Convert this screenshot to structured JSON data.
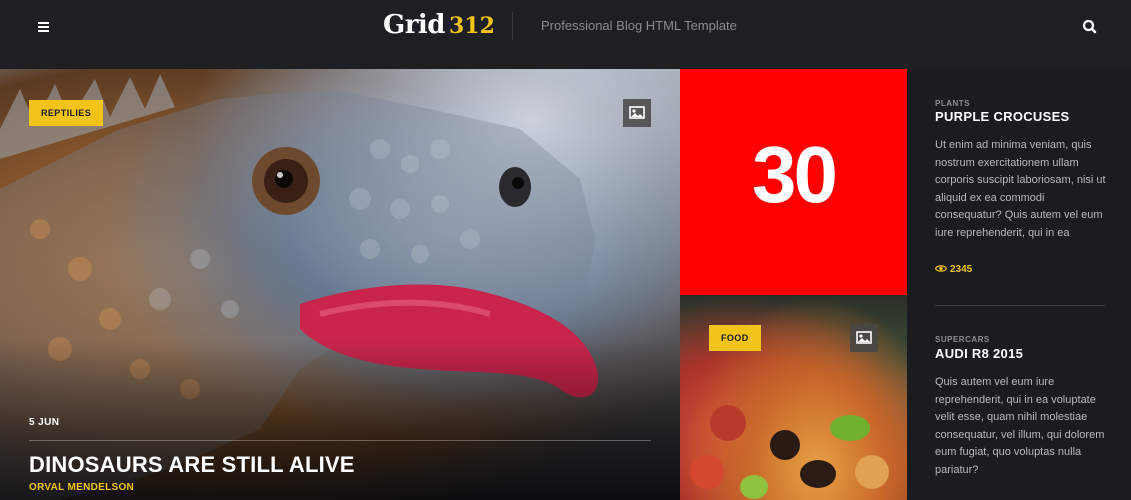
{
  "header": {
    "logo_word": "Grid",
    "logo_number": "312",
    "tagline": "Professional Blog HTML Template"
  },
  "hero": {
    "category": "REPTILIES",
    "date": "5 JUN",
    "title": "DINOSAURS ARE STILL ALIVE",
    "author": "ORVAL MENDELSON"
  },
  "stat": {
    "number": "30"
  },
  "food": {
    "category": "FOOD"
  },
  "sidebar": {
    "posts": [
      {
        "category": "PLANTS",
        "title": "PURPLE CROCUSES",
        "excerpt": "Ut enim ad minima veniam, quis nostrum exercitationem ullam corporis suscipit laboriosam, nisi ut aliquid ex ea commodi consequatur? Quis autem vel eum iure reprehenderit, qui in ea",
        "views": "2345"
      },
      {
        "category": "SUPERCARS",
        "title": "AUDI R8 2015",
        "excerpt": "Quis autem vel eum iure reprehenderit, qui in ea voluptate velit esse, quam nihil molestiae consequatur, vel illum, qui dolorem eum fugiat, quo voluptas nulla pariatur?"
      }
    ]
  },
  "colors": {
    "accent": "#f2c318",
    "stat_bg": "#ff0000",
    "header_bg": "#1e1f23",
    "sidebar_bg": "#1b1c20"
  },
  "icons": [
    "menu-icon",
    "search-icon",
    "image-icon",
    "eye-icon"
  ]
}
